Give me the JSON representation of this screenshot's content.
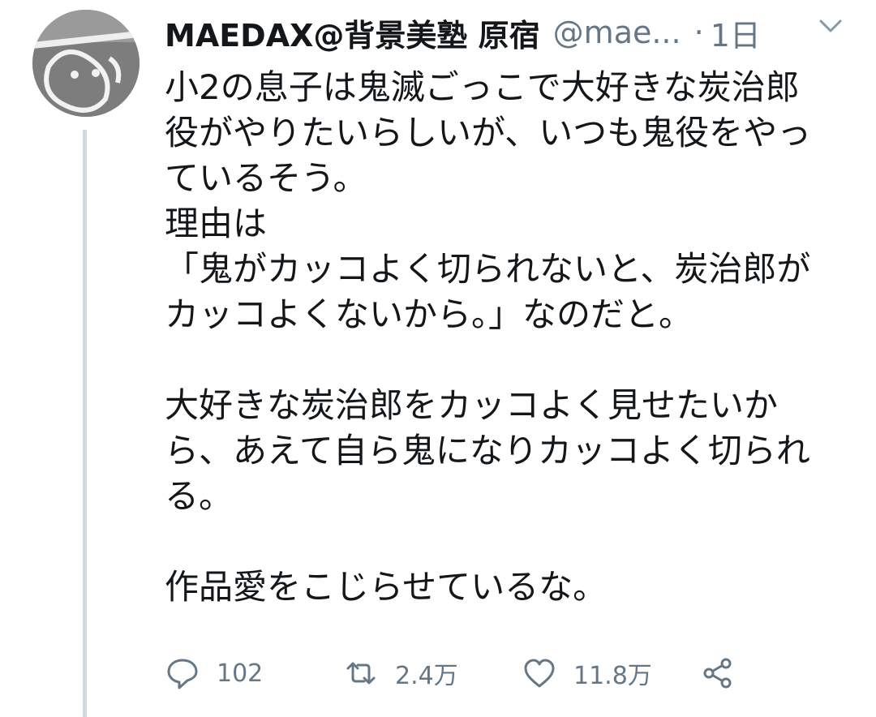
{
  "tweet": {
    "author_name": "MAEDAX@背景美塾 原宿",
    "handle": "@mae...",
    "separator": "·",
    "time": "1日",
    "lines": [
      "小2の息子は鬼滅ごっこで大好きな炭治郎",
      "役がやりたいらしいが、いつも鬼役をやっ",
      "ているそう。",
      "理由は",
      "「鬼がカッコよく切られないと、炭治郎が",
      "カッコよくないから。」なのだと。",
      "",
      "大好きな炭治郎をカッコよく見せたいか",
      "ら、あえて自ら鬼になりカッコよく切られ",
      "る。",
      "",
      "作品愛をこじらせているな。"
    ]
  },
  "actions": {
    "reply_count": "102",
    "retweet_count": "2.4万",
    "like_count": "11.8万"
  },
  "icons": [
    "avatar",
    "chevron-down-icon",
    "reply-icon",
    "retweet-icon",
    "like-icon",
    "share-icon"
  ],
  "colors": {
    "text": "#14171a",
    "secondary": "#657786",
    "thread_line": "#cfd9de"
  }
}
